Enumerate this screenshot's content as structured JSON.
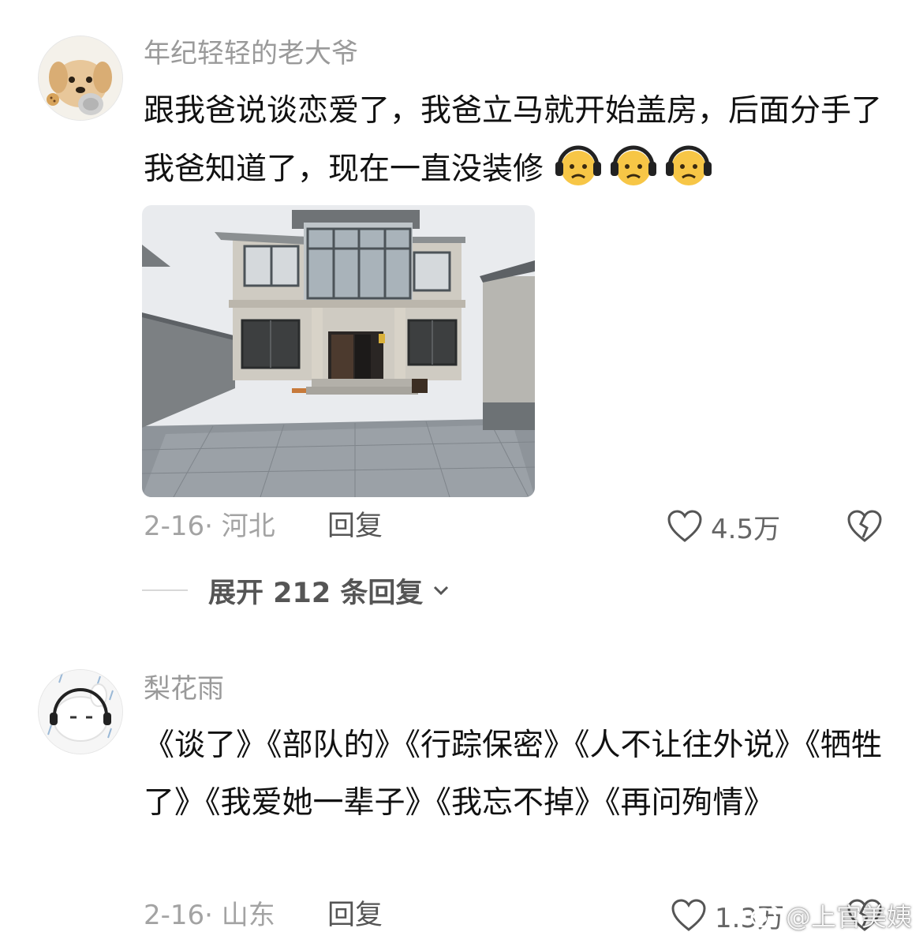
{
  "comments": [
    {
      "username": "年纪轻轻的老大爷",
      "text": "跟我爸说谈恋爱了，我爸立马就开始盖房，后面分手了我爸知道了，现在一直没装修",
      "emojis": [
        "sad-headphones-face-emoji",
        "sad-headphones-face-emoji",
        "sad-headphones-face-emoji"
      ],
      "date": "2-16· 河北",
      "reply_label": "回复",
      "likes": "4.5万",
      "expand_label": "展开 212 条回复"
    },
    {
      "username": "梨花雨",
      "text": "《谈了》《部队的》《行踪保密》《人不让往外说》《牺牲了》《我爱她一辈子》《我忘不掉》《再问殉情》",
      "date": "2-16· 山东",
      "reply_label": "回复",
      "likes": "1.3万"
    }
  ],
  "watermark": "@上官美姨",
  "colors": {
    "meta_gray": "#a3a3a3",
    "username_gray": "#9a9a9a",
    "text": "#111111"
  }
}
